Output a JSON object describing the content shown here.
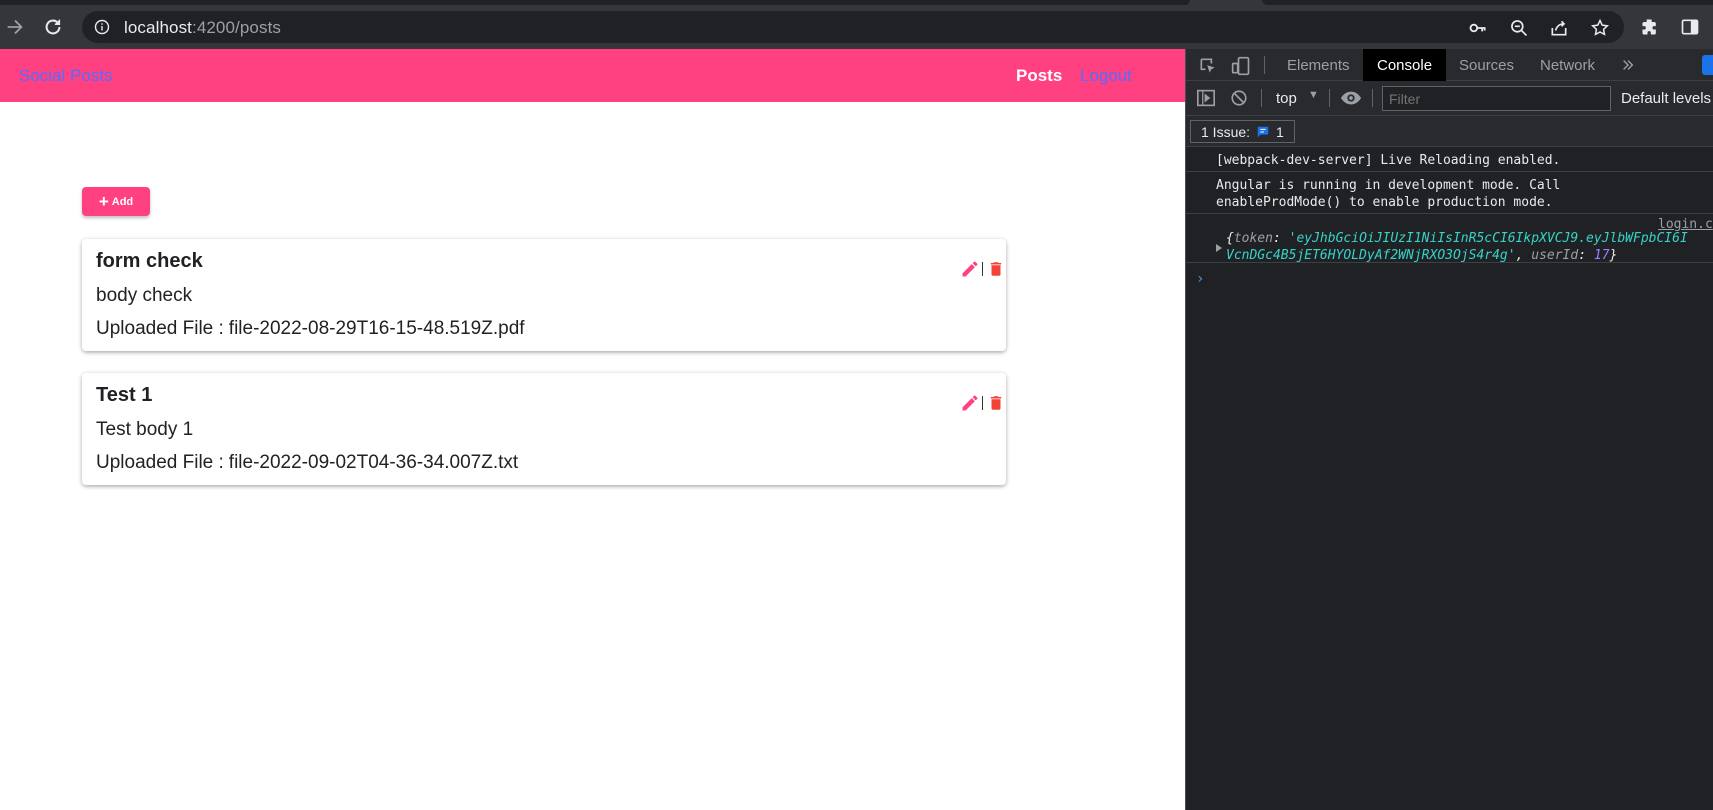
{
  "browser": {
    "url_host": "localhost",
    "url_path": ":4200/posts"
  },
  "app": {
    "brand": "Social Posts",
    "nav_posts": "Posts",
    "nav_logout": "Logout",
    "add_label": "Add",
    "file_label": "Uploaded File :",
    "posts": [
      {
        "title": "form check",
        "body": "body check",
        "file": "file-2022-08-29T16-15-48.519Z.pdf"
      },
      {
        "title": "Test 1",
        "body": "Test body 1",
        "file": "file-2022-09-02T04-36-34.007Z.txt"
      }
    ]
  },
  "devtools": {
    "tabs": [
      "Elements",
      "Console",
      "Sources",
      "Network"
    ],
    "active_tab": "Console",
    "context": "top",
    "filter_placeholder": "Filter",
    "levels": "Default levels",
    "issues_label": "1 Issue:",
    "issues_count": "1",
    "log1": "[webpack-dev-server] Live Reloading enabled.",
    "log2_line1": "Angular is running in development mode. Call",
    "log2_line2": "enableProdMode() to enable production mode.",
    "log3_source": "login.c",
    "log3_token_key": "token",
    "log3_token_val_1": "'eyJhbGciOiJIUzI1NiIsInR5cCI6IkpXVCJ9.eyJlbWFpbCI6I",
    "log3_token_val_2": "VcnDGc4B5jET6HYOLDyAf2WNjRXO3OjS4r4g'",
    "log3_user_key": "userId",
    "log3_user_val": "17"
  },
  "colors": {
    "accent": "#ff4081",
    "link": "#536dfe",
    "delete": "#f44336"
  }
}
